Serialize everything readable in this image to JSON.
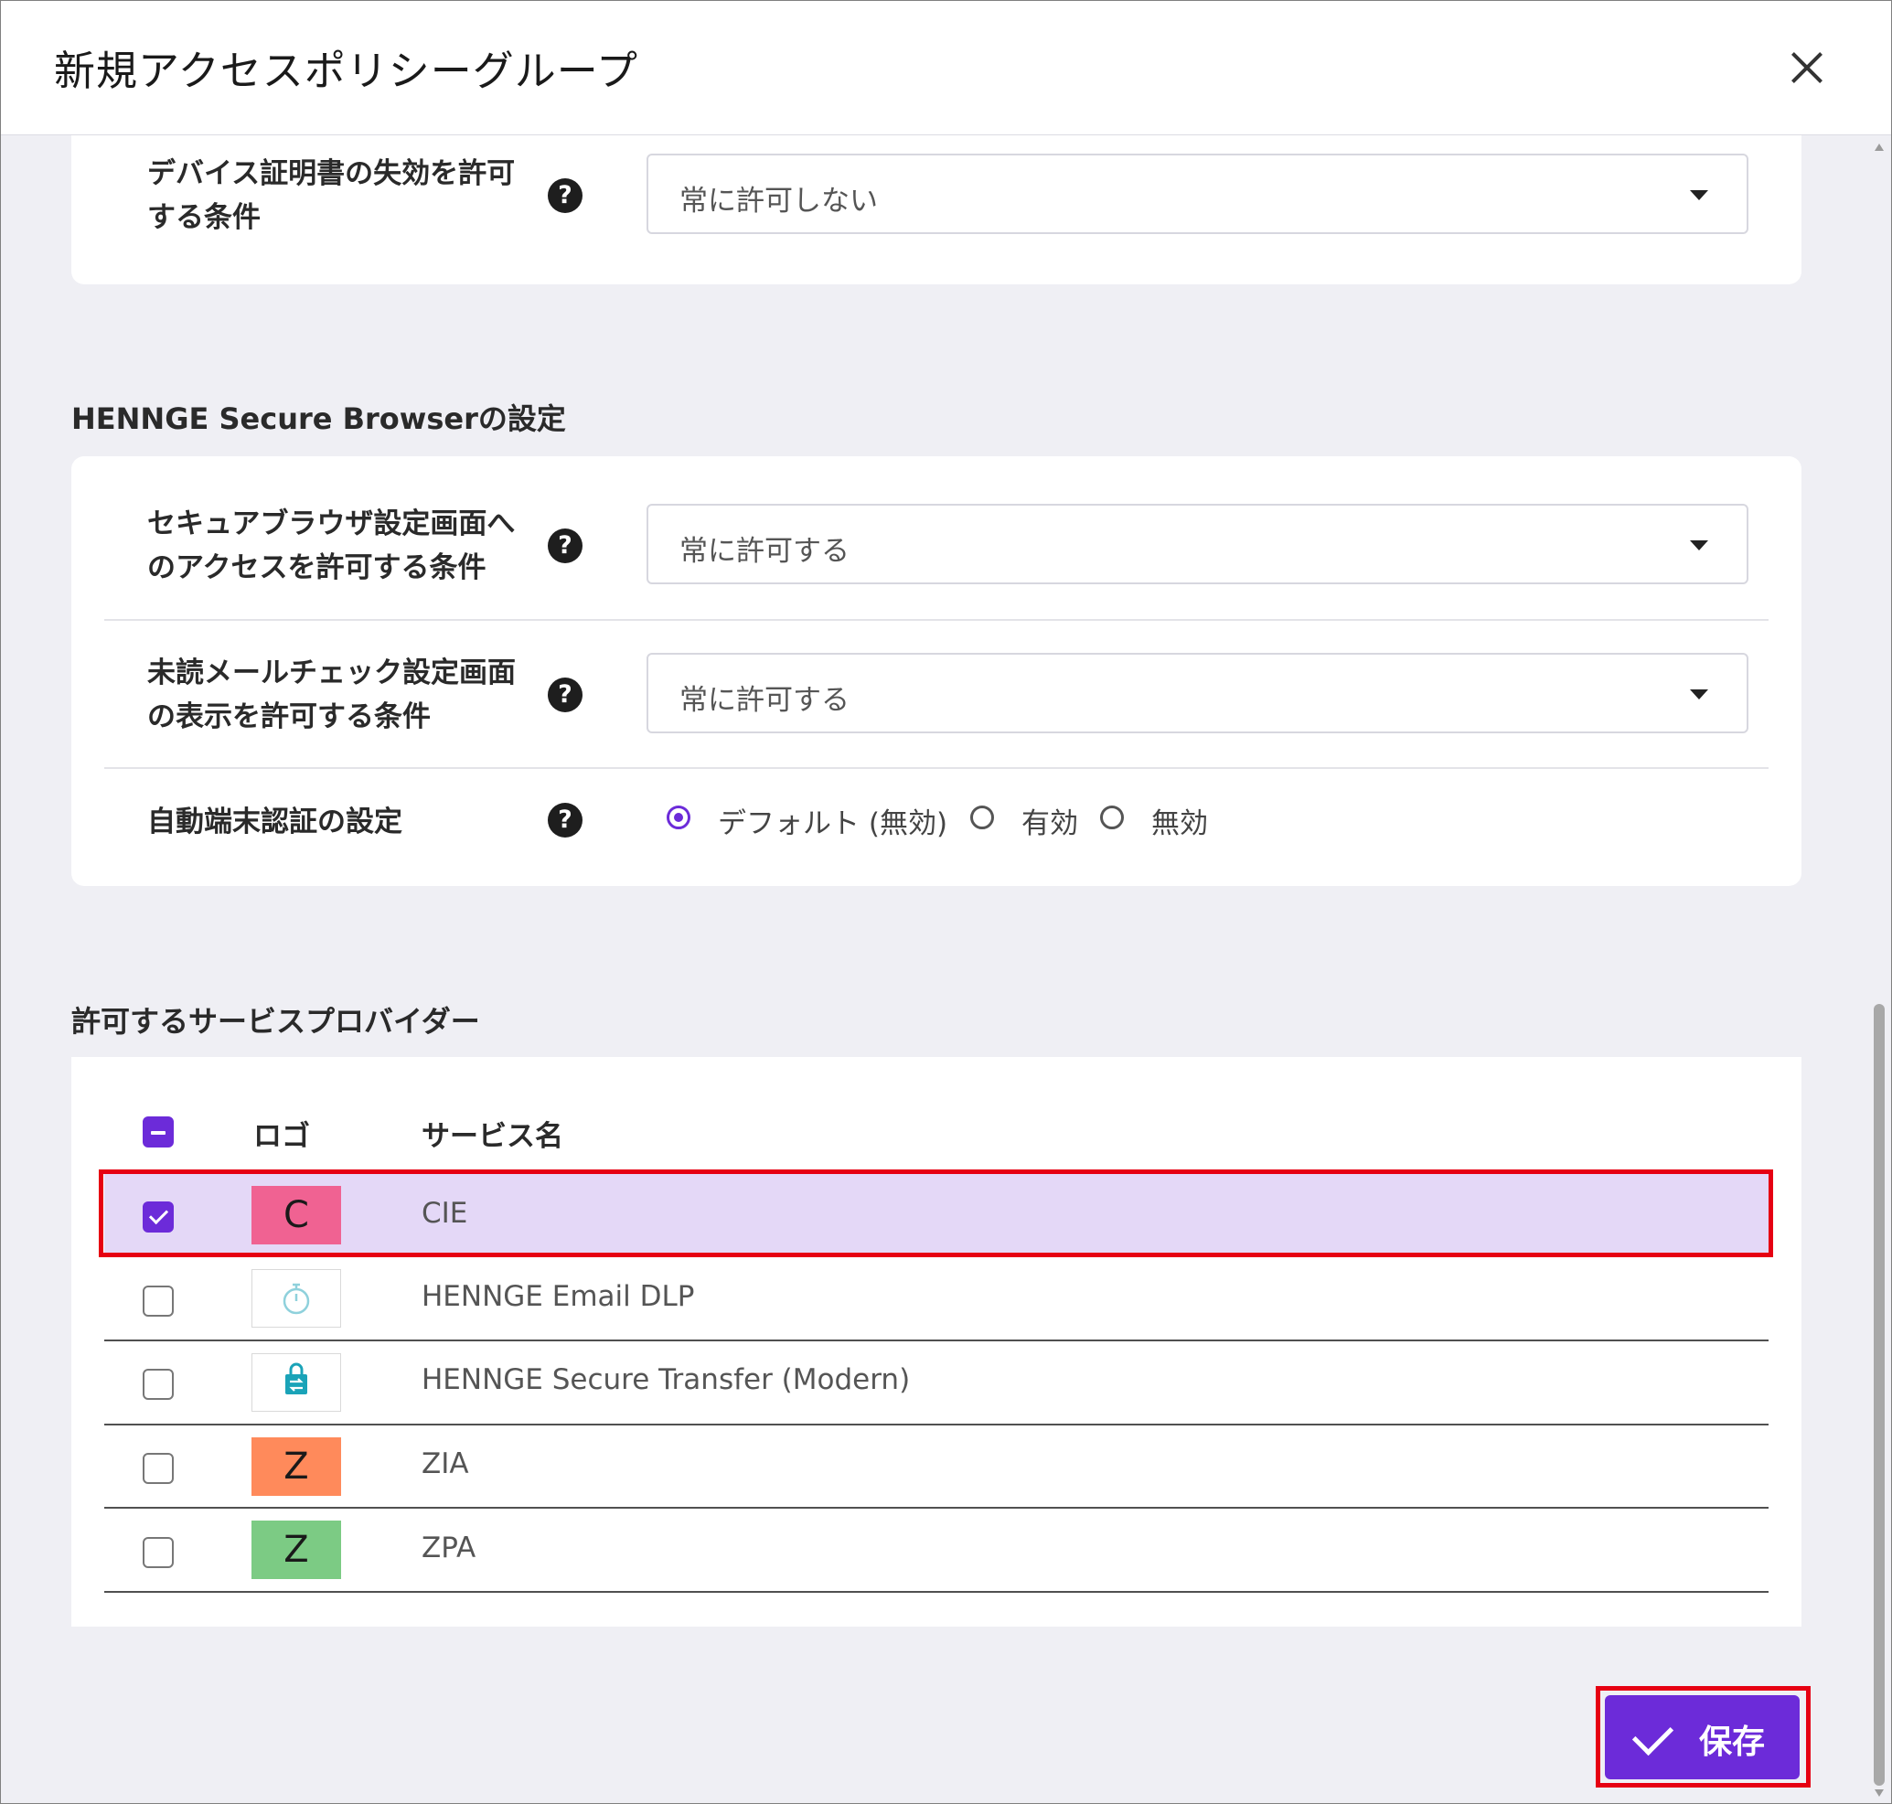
{
  "dialog": {
    "title": "新規アクセスポリシーグループ",
    "close_icon": "close-icon"
  },
  "device_cert": {
    "label": "デバイス証明書の失効を許可する条件",
    "value": "常に許可しない"
  },
  "secure_browser": {
    "section_title": "HENNGE Secure Browserの設定",
    "settings_access": {
      "label": "セキュアブラウザ設定画面へのアクセスを許可する条件",
      "value": "常に許可する"
    },
    "unread_mail": {
      "label": "未読メールチェック設定画面の表示を許可する条件",
      "value": "常に許可する"
    },
    "auto_auth": {
      "label": "自動端末認証の設定",
      "options": [
        "デフォルト (無効)",
        "有効",
        "無効"
      ],
      "selected": "デフォルト (無効)"
    }
  },
  "providers": {
    "section_title": "許可するサービスプロバイダー",
    "columns": [
      "ロゴ",
      "サービス名"
    ],
    "rows": [
      {
        "logo_text": "C",
        "logo_color": "#f06292",
        "name": "CIE",
        "checked": true
      },
      {
        "logo_icon": "stopwatch-icon",
        "logo_color": "#ffffff",
        "name": "HENNGE Email DLP",
        "checked": false
      },
      {
        "logo_icon": "secure-transfer-icon",
        "logo_color": "#ffffff",
        "name": "HENNGE Secure Transfer (Modern)",
        "checked": false
      },
      {
        "logo_text": "Z",
        "logo_color": "#ff8a5b",
        "name": "ZIA",
        "checked": false
      },
      {
        "logo_text": "Z",
        "logo_color": "#7ccb84",
        "name": "ZPA",
        "checked": false
      }
    ]
  },
  "footer": {
    "save_label": "保存"
  },
  "colors": {
    "accent": "#6c2bd9",
    "highlight": "#e60012",
    "selected_row": "#e4d8f7"
  }
}
